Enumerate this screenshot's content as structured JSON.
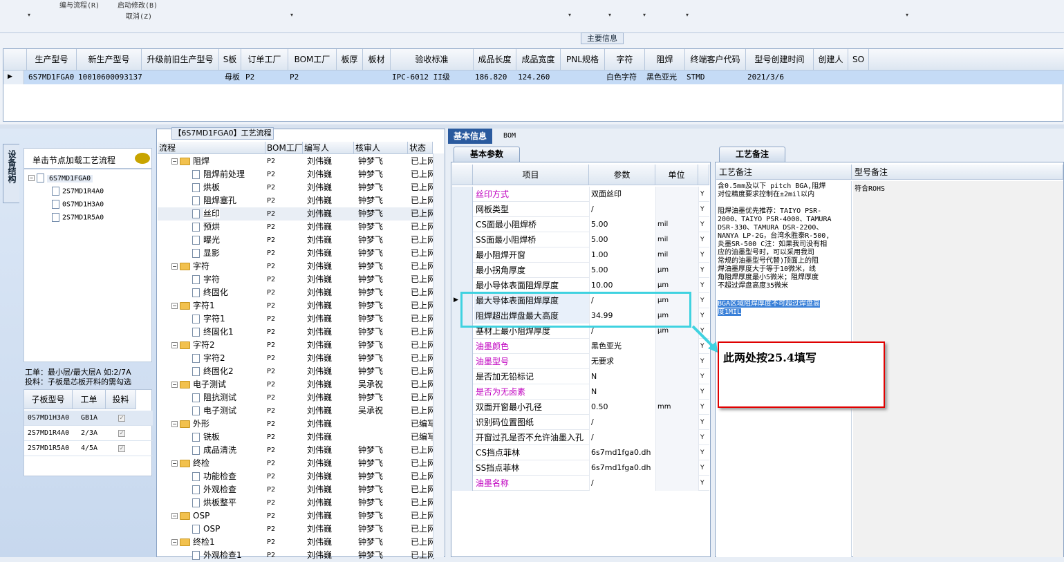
{
  "toolbar": {
    "items": [
      "编与流程(R)",
      "启动修改(B)",
      "取消(Z)"
    ]
  },
  "main_info": {
    "title": "主要信息",
    "columns": [
      "生产型号",
      "新生产型号",
      "升级前旧生产型号",
      "S板",
      "订单工厂",
      "BOM工厂",
      "板厚",
      "板材",
      "验收标准",
      "成品长度",
      "成品宽度",
      "PNL规格",
      "字符",
      "阻焊",
      "终端客户代码",
      "型号创建时间",
      "创建人",
      "SO"
    ],
    "row": {
      "production_model": "6S7MD1FGA0",
      "new_model": "10010600093137",
      "old_model": "",
      "s_board": "母板",
      "order_factory": "P2",
      "bom_factory": "P2",
      "thickness": "",
      "material": "",
      "standard": "IPC-6012 II级",
      "length": "186.820",
      "width": "124.260",
      "pnl": "",
      "character": "白色字符",
      "solder_mask": "黑色亚光",
      "customer_code": "STMD",
      "created": "2021/3/6",
      "creator": "",
      "so": ""
    }
  },
  "left_panel": {
    "vertical_tab": "设备结构",
    "hint": "单击节点加载工艺流程",
    "tree": {
      "root": "6S7MD1FGA0",
      "children": [
        "2S7MD1R4A0",
        "0S7MD1H3A0",
        "2S7MD1R5A0"
      ]
    },
    "note_line1": "工单：最小层/最大层A 如:2/7A",
    "note_line2": "投料：子板是芯板开料的需勾选",
    "subgrid": {
      "columns": [
        "子板型号",
        "工单",
        "投料"
      ],
      "rows": [
        {
          "model": "0S7MD1H3A0",
          "order": "GB1A"
        },
        {
          "model": "2S7MD1R4A0",
          "order": "2/3A"
        },
        {
          "model": "2S7MD1R5A0",
          "order": "4/5A"
        }
      ]
    }
  },
  "process": {
    "title": "【6S7MD1FGA0】工艺流程",
    "columns": [
      "流程",
      "BOM工厂",
      "编写人",
      "核审人",
      "状态"
    ],
    "rows": [
      {
        "name": "阻焊",
        "level": 0,
        "factory": "P2",
        "writer": "刘伟巍",
        "reviewer": "钟梦飞",
        "status": "已上网"
      },
      {
        "name": "阻焊前处理",
        "level": 1,
        "factory": "P2",
        "writer": "刘伟巍",
        "reviewer": "钟梦飞",
        "status": "已上网"
      },
      {
        "name": "烘板",
        "level": 1,
        "factory": "P2",
        "writer": "刘伟巍",
        "reviewer": "钟梦飞",
        "status": "已上网"
      },
      {
        "name": "阻焊塞孔",
        "level": 1,
        "factory": "P2",
        "writer": "刘伟巍",
        "reviewer": "钟梦飞",
        "status": "已上网"
      },
      {
        "name": "丝印",
        "level": 1,
        "factory": "P2",
        "writer": "刘伟巍",
        "reviewer": "钟梦飞",
        "status": "已上网"
      },
      {
        "name": "预烘",
        "level": 1,
        "factory": "P2",
        "writer": "刘伟巍",
        "reviewer": "钟梦飞",
        "status": "已上网"
      },
      {
        "name": "曝光",
        "level": 1,
        "factory": "P2",
        "writer": "刘伟巍",
        "reviewer": "钟梦飞",
        "status": "已上网"
      },
      {
        "name": "显影",
        "level": 1,
        "factory": "P2",
        "writer": "刘伟巍",
        "reviewer": "钟梦飞",
        "status": "已上网"
      },
      {
        "name": "字符",
        "level": 0,
        "factory": "P2",
        "writer": "刘伟巍",
        "reviewer": "钟梦飞",
        "status": "已上网"
      },
      {
        "name": "字符",
        "level": 1,
        "factory": "P2",
        "writer": "刘伟巍",
        "reviewer": "钟梦飞",
        "status": "已上网"
      },
      {
        "name": "终固化",
        "level": 1,
        "factory": "P2",
        "writer": "刘伟巍",
        "reviewer": "钟梦飞",
        "status": "已上网"
      },
      {
        "name": "字符1",
        "level": 0,
        "factory": "P2",
        "writer": "刘伟巍",
        "reviewer": "钟梦飞",
        "status": "已上网"
      },
      {
        "name": "字符1",
        "level": 1,
        "factory": "P2",
        "writer": "刘伟巍",
        "reviewer": "钟梦飞",
        "status": "已上网"
      },
      {
        "name": "终固化1",
        "level": 1,
        "factory": "P2",
        "writer": "刘伟巍",
        "reviewer": "钟梦飞",
        "status": "已上网"
      },
      {
        "name": "字符2",
        "level": 0,
        "factory": "P2",
        "writer": "刘伟巍",
        "reviewer": "钟梦飞",
        "status": "已上网"
      },
      {
        "name": "字符2",
        "level": 1,
        "factory": "P2",
        "writer": "刘伟巍",
        "reviewer": "钟梦飞",
        "status": "已上网"
      },
      {
        "name": "终固化2",
        "level": 1,
        "factory": "P2",
        "writer": "刘伟巍",
        "reviewer": "钟梦飞",
        "status": "已上网"
      },
      {
        "name": "电子测试",
        "level": 0,
        "factory": "P2",
        "writer": "刘伟巍",
        "reviewer": "吴承祝",
        "status": "已上网"
      },
      {
        "name": "阻抗测试",
        "level": 1,
        "factory": "P2",
        "writer": "刘伟巍",
        "reviewer": "钟梦飞",
        "status": "已上网"
      },
      {
        "name": "电子测试",
        "level": 1,
        "factory": "P2",
        "writer": "刘伟巍",
        "reviewer": "吴承祝",
        "status": "已上网"
      },
      {
        "name": "外形",
        "level": 0,
        "factory": "P2",
        "writer": "刘伟巍",
        "reviewer": "",
        "status": "已编写"
      },
      {
        "name": "铣板",
        "level": 1,
        "factory": "P2",
        "writer": "刘伟巍",
        "reviewer": "",
        "status": "已编写"
      },
      {
        "name": "成品清洗",
        "level": 1,
        "factory": "P2",
        "writer": "刘伟巍",
        "reviewer": "钟梦飞",
        "status": "已上网"
      },
      {
        "name": "终检",
        "level": 0,
        "factory": "P2",
        "writer": "刘伟巍",
        "reviewer": "钟梦飞",
        "status": "已上网"
      },
      {
        "name": "功能检查",
        "level": 1,
        "factory": "P2",
        "writer": "刘伟巍",
        "reviewer": "钟梦飞",
        "status": "已上网"
      },
      {
        "name": "外观检查",
        "level": 1,
        "factory": "P2",
        "writer": "刘伟巍",
        "reviewer": "钟梦飞",
        "status": "已上网"
      },
      {
        "name": "烘板整平",
        "level": 1,
        "factory": "P2",
        "writer": "刘伟巍",
        "reviewer": "钟梦飞",
        "status": "已上网"
      },
      {
        "name": "OSP",
        "level": 0,
        "factory": "P2",
        "writer": "刘伟巍",
        "reviewer": "钟梦飞",
        "status": "已上网"
      },
      {
        "name": "OSP",
        "level": 1,
        "factory": "P2",
        "writer": "刘伟巍",
        "reviewer": "钟梦飞",
        "status": "已上网"
      },
      {
        "name": "终检1",
        "level": 0,
        "factory": "P2",
        "writer": "刘伟巍",
        "reviewer": "钟梦飞",
        "status": "已上网"
      },
      {
        "name": "外观检查1",
        "level": 1,
        "factory": "P2",
        "writer": "刘伟巍",
        "reviewer": "钟梦飞",
        "status": "已上网"
      }
    ]
  },
  "right_tabs": {
    "basic_info": "基本信息",
    "bom": "BOM",
    "params_tab": "基本参数",
    "notes_tab": "工艺备注"
  },
  "params": {
    "columns": [
      "项目",
      "参数",
      "单位"
    ],
    "rows": [
      {
        "item": "丝印方式",
        "value": "双面丝印",
        "unit": "",
        "y": "Y",
        "magenta": true
      },
      {
        "item": "网板类型",
        "value": "/",
        "unit": "",
        "y": "Y",
        "magenta": false
      },
      {
        "item": "CS面最小阻焊桥",
        "value": "5.00",
        "unit": "mil",
        "y": "Y",
        "magenta": false
      },
      {
        "item": "SS面最小阻焊桥",
        "value": "5.00",
        "unit": "mil",
        "y": "Y",
        "magenta": false
      },
      {
        "item": "最小阻焊开窗",
        "value": "1.00",
        "unit": "mil",
        "y": "Y",
        "magenta": false
      },
      {
        "item": "最小拐角厚度",
        "value": "5.00",
        "unit": "μm",
        "y": "Y",
        "magenta": false
      },
      {
        "item": "最小导体表面阻焊厚度",
        "value": "10.00",
        "unit": "μm",
        "y": "Y",
        "magenta": false
      },
      {
        "item": "最大导体表面阻焊厚度",
        "value": "/",
        "unit": "μm",
        "y": "Y",
        "magenta": false
      },
      {
        "item": "阻焊超出焊盘最大高度",
        "value": "34.99",
        "unit": "μm",
        "y": "Y",
        "magenta": false
      },
      {
        "item": "基材上最小阻焊厚度",
        "value": "/",
        "unit": "μm",
        "y": "Y",
        "magenta": false
      },
      {
        "item": "油墨颜色",
        "value": "黑色亚光",
        "unit": "",
        "y": "Y",
        "magenta": true
      },
      {
        "item": "油墨型号",
        "value": "无要求",
        "unit": "",
        "y": "Y",
        "magenta": true
      },
      {
        "item": "是否加无铅标记",
        "value": "N",
        "unit": "",
        "y": "Y",
        "magenta": false
      },
      {
        "item": "是否为无卤素",
        "value": "N",
        "unit": "",
        "y": "Y",
        "magenta": true
      },
      {
        "item": "双面开窗最小孔径",
        "value": "0.50",
        "unit": "mm",
        "y": "Y",
        "magenta": false
      },
      {
        "item": "识别码位置图纸",
        "value": "/",
        "unit": "",
        "y": "Y",
        "magenta": false
      },
      {
        "item": "开窗过孔是否不允许油墨入孔",
        "value": "/",
        "unit": "",
        "y": "Y",
        "magenta": false
      },
      {
        "item": "CS挡点菲林",
        "value": "6s7md1fga0.dh",
        "unit": "",
        "y": "Y",
        "magenta": false
      },
      {
        "item": "SS挡点菲林",
        "value": "6s7md1fga0.dh",
        "unit": "",
        "y": "Y",
        "magenta": false
      },
      {
        "item": "油墨名称",
        "value": "/",
        "unit": "",
        "y": "Y",
        "magenta": true
      }
    ]
  },
  "notes": {
    "proc_header": "工艺备注",
    "model_header": "型号备注",
    "proc_lines": [
      "含0.5mm及以下 pitch BGA,阻焊",
      "对位精度要求控制在±2mil以内",
      "",
      "阻焊油墨优先推荐：TAIYO PSR-",
      "2000、TAIYO PSR-4000、TAMURA",
      "DSR-330、TAMURA DSR-2200、",
      "NANYA LP-2G，台湾永胜泰R-500,",
      "炎墨SR-500 C注：如果我司没有相",
      "应的油墨型号时，可以采用我司",
      "常规的油墨型号代替)顶面上的阻",
      "焊油墨厚度大于等于10微米，线",
      "角阻焊厚度最小5微米；阻焊厚度",
      "不超过焊盘高度35微米"
    ],
    "proc_highlight": [
      "BGA区域阻焊厚度不可超过焊盘高",
      "度1MIL"
    ],
    "model_note": "符合ROHS"
  },
  "annotation": {
    "callout": "此两处按25.4填写",
    "highlight_color": "#3fd2e0",
    "callout_border": "#e00000"
  }
}
